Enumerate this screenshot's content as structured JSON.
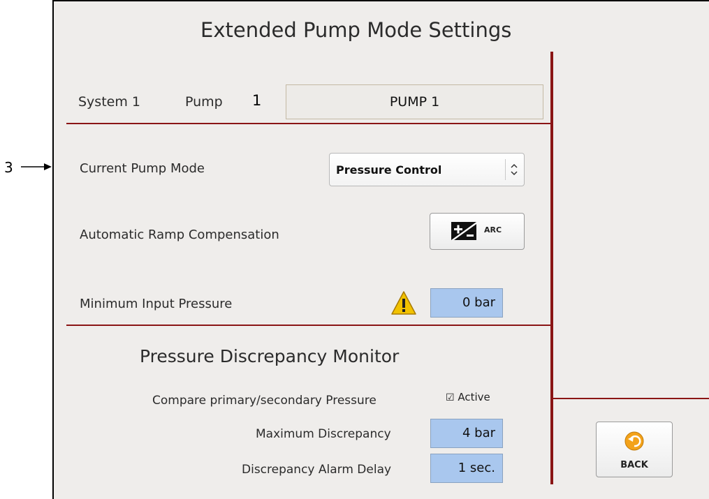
{
  "outside": {
    "annotation_number": "3"
  },
  "header": {
    "title": "Extended Pump Mode Settings"
  },
  "system": {
    "system_label": "System 1",
    "pump_label": "Pump",
    "pump_number": "1",
    "pump_name": "PUMP 1"
  },
  "settings": {
    "current_mode_label": "Current Pump Mode",
    "current_mode_value": "Pressure Control",
    "arc_label": "Automatic Ramp Compensation",
    "arc_button_text": "ARC",
    "min_pressure_label": "Minimum Input Pressure",
    "min_pressure_value": "0 bar"
  },
  "discrepancy": {
    "title": "Pressure Discrepancy Monitor",
    "compare_label": "Compare primary/secondary Pressure",
    "active_checked": true,
    "active_label": "Active",
    "max_label": "Maximum Discrepancy",
    "max_value": "4 bar",
    "delay_label": "Discrepancy Alarm Delay",
    "delay_value": "1 sec."
  },
  "back_button": {
    "label": "BACK"
  },
  "icons": [
    "right-arrow-icon",
    "chevron-updown-icon",
    "arc-icon",
    "warning-icon",
    "back-icon",
    "checkbox-checked-icon"
  ],
  "colors": {
    "divider": "#8a1515",
    "value_field": "#a9c7ee",
    "panel_bg": "#efedeb",
    "warning": "#f2c200",
    "back_icon": "#f3a21a"
  }
}
